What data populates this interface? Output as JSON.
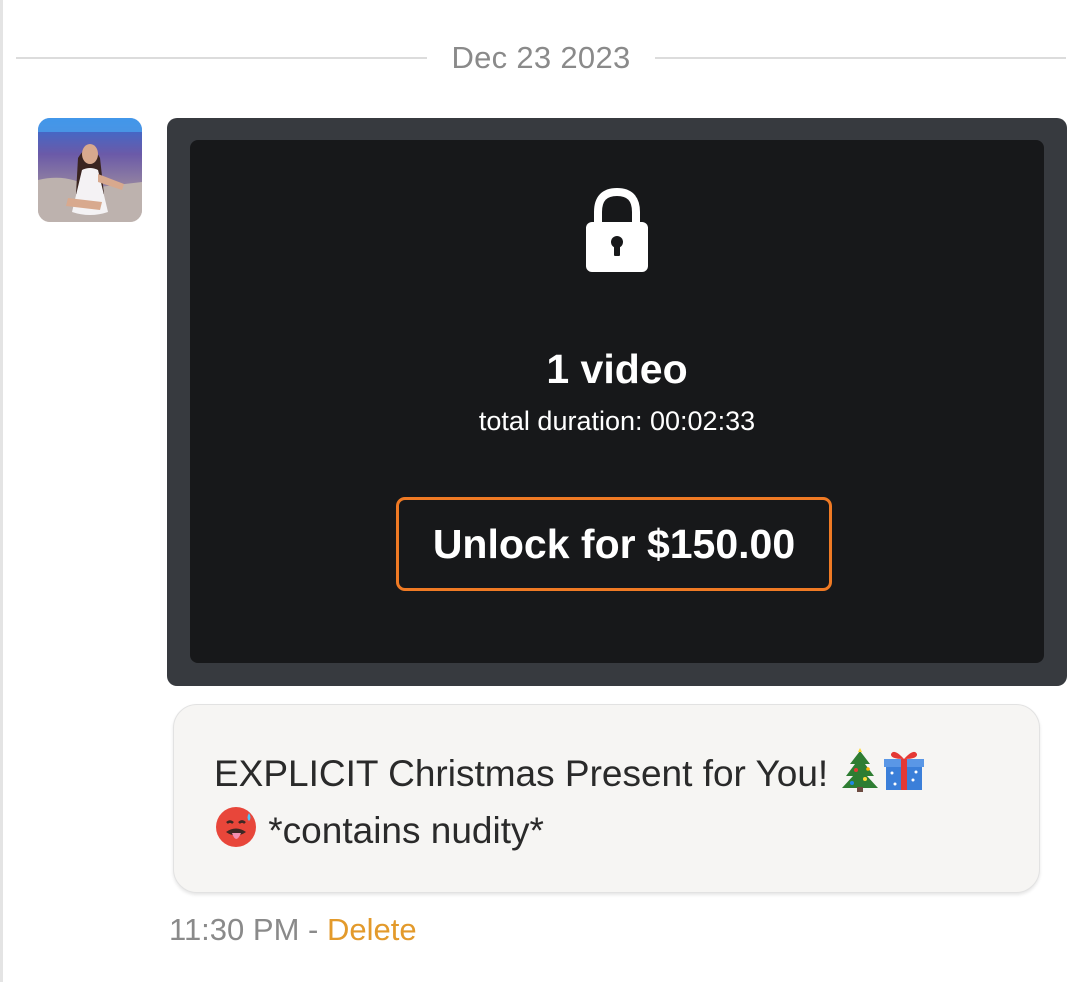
{
  "date_separator": "Dec 23 2023",
  "message": {
    "media": {
      "count_label": "1 video",
      "duration_label": "total duration: 00:02:33",
      "unlock_label": "Unlock for $150.00",
      "lock_icon": "lock-icon"
    },
    "text_before_emoji": "EXPLICIT Christmas Present for You! ",
    "text_after_emoji": " *contains nudity*",
    "emojis": [
      "christmas-tree-icon",
      "gift-icon",
      "hot-face-icon"
    ],
    "time": "11:30 PM",
    "separator": " - ",
    "delete_label": "Delete"
  },
  "colors": {
    "accent_orange": "#f07a24",
    "delete_link": "#e39a2b",
    "media_frame": "#373a3f",
    "media_inner": "#17181a",
    "bubble_bg": "#f6f5f3"
  }
}
